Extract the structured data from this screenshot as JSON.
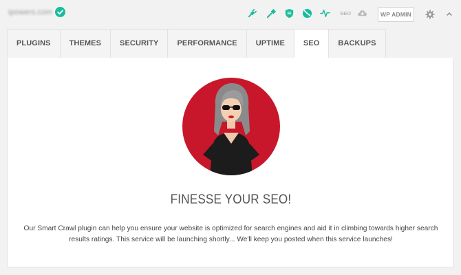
{
  "site": {
    "name": "ipowers.com"
  },
  "colors": {
    "brand_green": "#1abc9c",
    "hero_red": "#c8172b",
    "tab_border": "#e2e2e2",
    "muted_text": "#888888"
  },
  "header": {
    "icons": [
      "plugins-icon",
      "themes-icon",
      "security-icon",
      "performance-icon",
      "uptime-icon",
      "seo-icon",
      "backups-icon"
    ],
    "seo_label": "SEO",
    "wp_admin_label": "WP ADMIN"
  },
  "tabs": [
    {
      "label": "PLUGINS",
      "active": false
    },
    {
      "label": "THEMES",
      "active": false
    },
    {
      "label": "SECURITY",
      "active": false
    },
    {
      "label": "PERFORMANCE",
      "active": false
    },
    {
      "label": "UPTIME",
      "active": false
    },
    {
      "label": "SEO",
      "active": true
    },
    {
      "label": "BACKUPS",
      "active": false
    }
  ],
  "main": {
    "headline": "FINESSE YOUR SEO!",
    "body": "Our Smart Crawl plugin can help you ensure your website is optimized for search engines and aid it in climbing towards higher search results ratings. This service will be launching shortly... We'll keep you posted when this service launches!"
  }
}
